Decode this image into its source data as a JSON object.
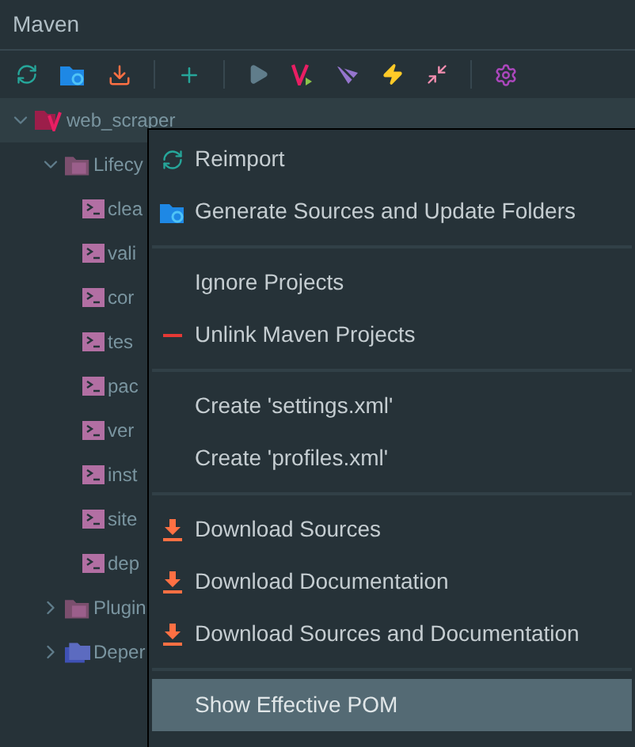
{
  "panel": {
    "title": "Maven"
  },
  "tree": [
    {
      "label": "web_scraper",
      "kind": "project",
      "expanded": true,
      "children": [
        {
          "label": "Lifecy",
          "kind": "folder",
          "expanded": true,
          "children": [
            {
              "label": "clea",
              "kind": "goal"
            },
            {
              "label": "vali",
              "kind": "goal"
            },
            {
              "label": "cor",
              "kind": "goal"
            },
            {
              "label": "tes",
              "kind": "goal"
            },
            {
              "label": "pac",
              "kind": "goal"
            },
            {
              "label": "ver",
              "kind": "goal"
            },
            {
              "label": "inst",
              "kind": "goal"
            },
            {
              "label": "site",
              "kind": "goal"
            },
            {
              "label": "dep",
              "kind": "goal"
            }
          ]
        },
        {
          "label": "Plugin",
          "kind": "folder",
          "expanded": false
        },
        {
          "label": "Deper",
          "kind": "deps",
          "expanded": false
        }
      ]
    }
  ],
  "menu": [
    [
      {
        "label": "Reimport",
        "kind": "sync",
        "selected": false
      },
      {
        "label": "Generate Sources and Update Folders",
        "kind": "folder",
        "selected": false
      }
    ],
    [
      {
        "label": "Ignore Projects",
        "kind": "plain",
        "selected": false
      },
      {
        "label": "Unlink Maven Projects",
        "kind": "remove",
        "selected": false
      }
    ],
    [
      {
        "label": "Create 'settings.xml'",
        "kind": "plain",
        "selected": false
      },
      {
        "label": "Create 'profiles.xml'",
        "kind": "plain",
        "selected": false
      }
    ],
    [
      {
        "label": "Download Sources",
        "kind": "download",
        "selected": false
      },
      {
        "label": "Download Documentation",
        "kind": "download",
        "selected": false
      },
      {
        "label": "Download Sources and Documentation",
        "kind": "download",
        "selected": false
      }
    ],
    [
      {
        "label": "Show Effective POM",
        "kind": "plain",
        "selected": true
      }
    ]
  ]
}
